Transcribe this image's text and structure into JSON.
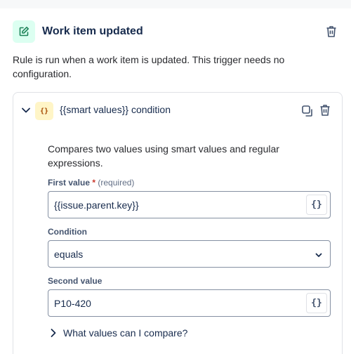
{
  "trigger": {
    "title": "Work item updated",
    "description": "Rule is run when a work item is updated. This trigger needs no configuration.",
    "icon": "edit-icon",
    "accent": "#1f845a"
  },
  "condition": {
    "title": "{{smart values}} condition",
    "icon_glyph": "{}",
    "description": "Compares two values using smart values and regular expressions.",
    "first_value": {
      "label": "First value",
      "required_star": "*",
      "required_text": "(required)",
      "value": "{{issue.parent.key}}"
    },
    "condition_field": {
      "label": "Condition",
      "selected": "equals"
    },
    "second_value": {
      "label": "Second value",
      "value": "P10-420"
    },
    "smart_value_button": "{}",
    "help_link": "What values can I compare?"
  }
}
